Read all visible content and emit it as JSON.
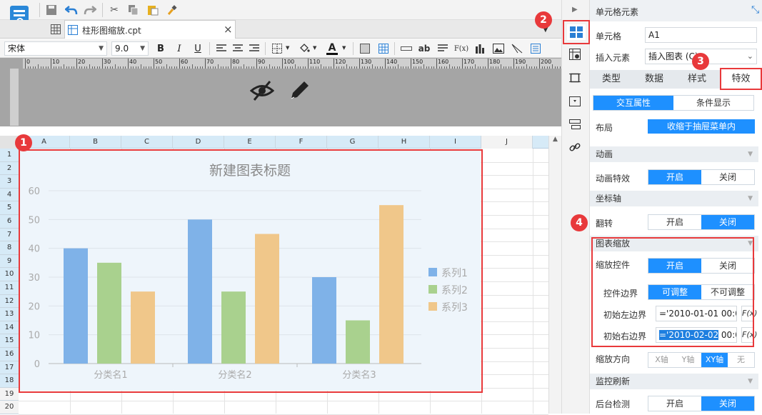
{
  "tab": {
    "filename": "柱形图缩放.cpt",
    "close": "×"
  },
  "format": {
    "font": "宋体",
    "size": "9.0",
    "bold": "B",
    "italic": "I",
    "underline": "U",
    "fx": "F(x)",
    "ab": "ab"
  },
  "columns": [
    "A",
    "B",
    "C",
    "D",
    "E",
    "F",
    "G",
    "H",
    "I",
    "J"
  ],
  "rows": [
    "1",
    "2",
    "3",
    "4",
    "5",
    "6",
    "7",
    "8",
    "9",
    "10",
    "11",
    "12",
    "13",
    "14",
    "15",
    "16",
    "17",
    "18",
    "19",
    "20"
  ],
  "ruler": [
    "0",
    "10",
    "20",
    "30",
    "40",
    "50",
    "60",
    "70",
    "80",
    "90",
    "100",
    "110",
    "120",
    "130",
    "140",
    "150",
    "160",
    "170",
    "180",
    "190",
    "200"
  ],
  "badges": {
    "b1": "1",
    "b2": "2",
    "b3": "3",
    "b4": "4"
  },
  "chart_data": {
    "type": "bar",
    "title": "新建图表标题",
    "categories": [
      "分类名1",
      "分类名2",
      "分类名3"
    ],
    "series": [
      {
        "name": "系列1",
        "values": [
          40,
          50,
          30
        ],
        "color": "#7fb2e8"
      },
      {
        "name": "系列2",
        "values": [
          35,
          25,
          15
        ],
        "color": "#a9d18e"
      },
      {
        "name": "系列3",
        "values": [
          25,
          45,
          55
        ],
        "color": "#f0c78a"
      }
    ],
    "yticks": [
      "0",
      "10",
      "20",
      "30",
      "40",
      "50",
      "60"
    ],
    "ylim": [
      0,
      60
    ],
    "legend": "right",
    "grid": true
  },
  "panel": {
    "title": "单元格元素",
    "cell_label": "单元格",
    "cell_value": "A1",
    "insert_label": "插入元素",
    "insert_value": "插入图表 (C)",
    "tabs": [
      "类型",
      "数据",
      "样式",
      "特效"
    ],
    "subtabs": [
      "交互属性",
      "条件显示"
    ],
    "layout_label": "布局",
    "layout_value": "收缩于抽屉菜单内",
    "anim_section": "动画",
    "anim_label": "动画特效",
    "axis_section": "坐标轴",
    "flip_label": "翻转",
    "zoom_section": "图表缩放",
    "zoom_ctrl_label": "缩放控件",
    "border_label": "控件边界",
    "adjustable": "可调整",
    "not_adjustable": "不可调整",
    "left_label": "初始左边界",
    "left_value": "='2010-01-01 00:00",
    "right_label": "初始右边界",
    "right_value_sel": "='2010-02-02",
    "right_value_rest": "00:00",
    "fx": "F(x)",
    "dir_label": "缩放方向",
    "dirs": [
      "X轴",
      "Y轴",
      "XY轴",
      "无"
    ],
    "monitor_section": "监控刷新",
    "backend_label": "后台检测",
    "on": "开启",
    "off": "关闭"
  },
  "colors": {
    "accent": "#1e90ff",
    "red": "#e8393b",
    "chartbg": "#eef5fb"
  }
}
